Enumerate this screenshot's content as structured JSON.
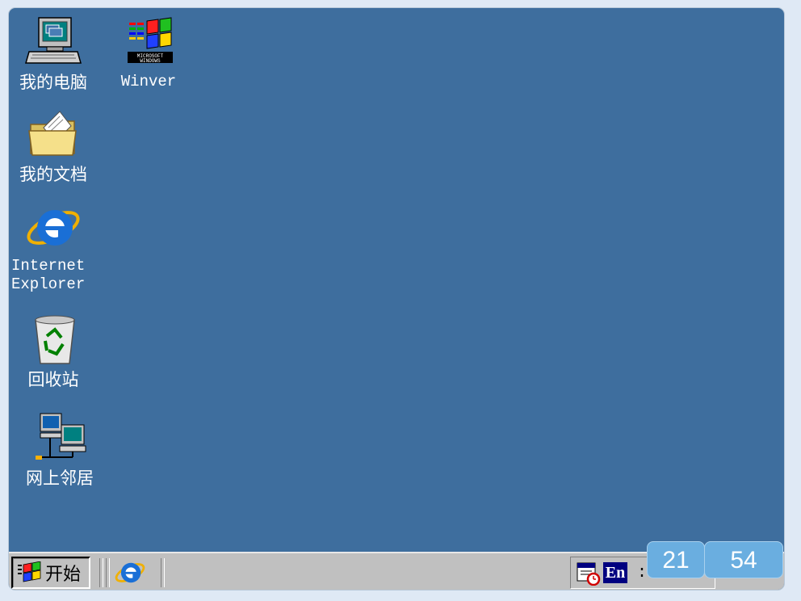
{
  "desktop": {
    "background_color": "#3e6e9e",
    "icons": [
      {
        "id": "my-computer",
        "label": "我的电脑",
        "icon": "computer-icon"
      },
      {
        "id": "winver",
        "label": "Winver",
        "icon": "windows-logo-icon"
      },
      {
        "id": "my-documents",
        "label": "我的文档",
        "icon": "folder-icon"
      },
      {
        "id": "internet-explorer",
        "label_line1": "Internet",
        "label_line2": "Explorer",
        "icon": "ie-icon"
      },
      {
        "id": "recycle-bin",
        "label": "回收站",
        "icon": "recycle-bin-icon"
      },
      {
        "id": "network-neighborhood",
        "label": "网上邻居",
        "icon": "network-icon"
      }
    ]
  },
  "taskbar": {
    "start_label": "开始",
    "quick_launch": [
      {
        "icon": "ie-icon"
      }
    ],
    "tray": {
      "lang": "En",
      "colon": ":"
    },
    "clock": {
      "hour": "21",
      "minute": "54"
    }
  }
}
